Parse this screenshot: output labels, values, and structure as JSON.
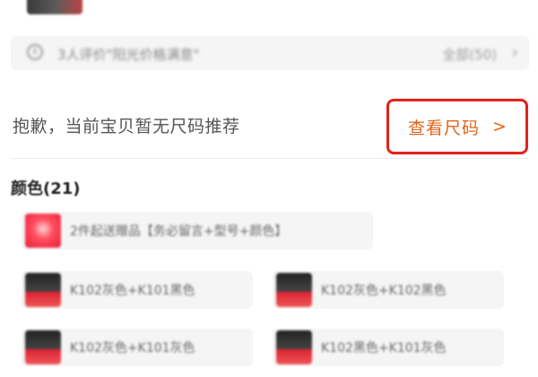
{
  "review": {
    "text": "3人评价\"阳光价格满意\"",
    "count": "全部(50)",
    "chevron": "›"
  },
  "size_section": {
    "message": "抱歉，当前宝贝暂无尺码推荐",
    "link_label": "查看尺码",
    "link_chevron": ">",
    "highlight_color": "#e2231a",
    "accent_color": "#e0651a"
  },
  "colors": {
    "heading": "颜色(21)",
    "swatches": [
      {
        "label": "2件起送赠品【务必留言+型号+颜色】",
        "thumb": "red"
      },
      {
        "label": "K102灰色+K101黑色",
        "thumb": "dark"
      },
      {
        "label": "K102灰色+K102黑色",
        "thumb": "dark"
      },
      {
        "label": "K102灰色+K101灰色",
        "thumb": "dark"
      },
      {
        "label": "K102黑色+K101灰色",
        "thumb": "dark"
      }
    ]
  }
}
